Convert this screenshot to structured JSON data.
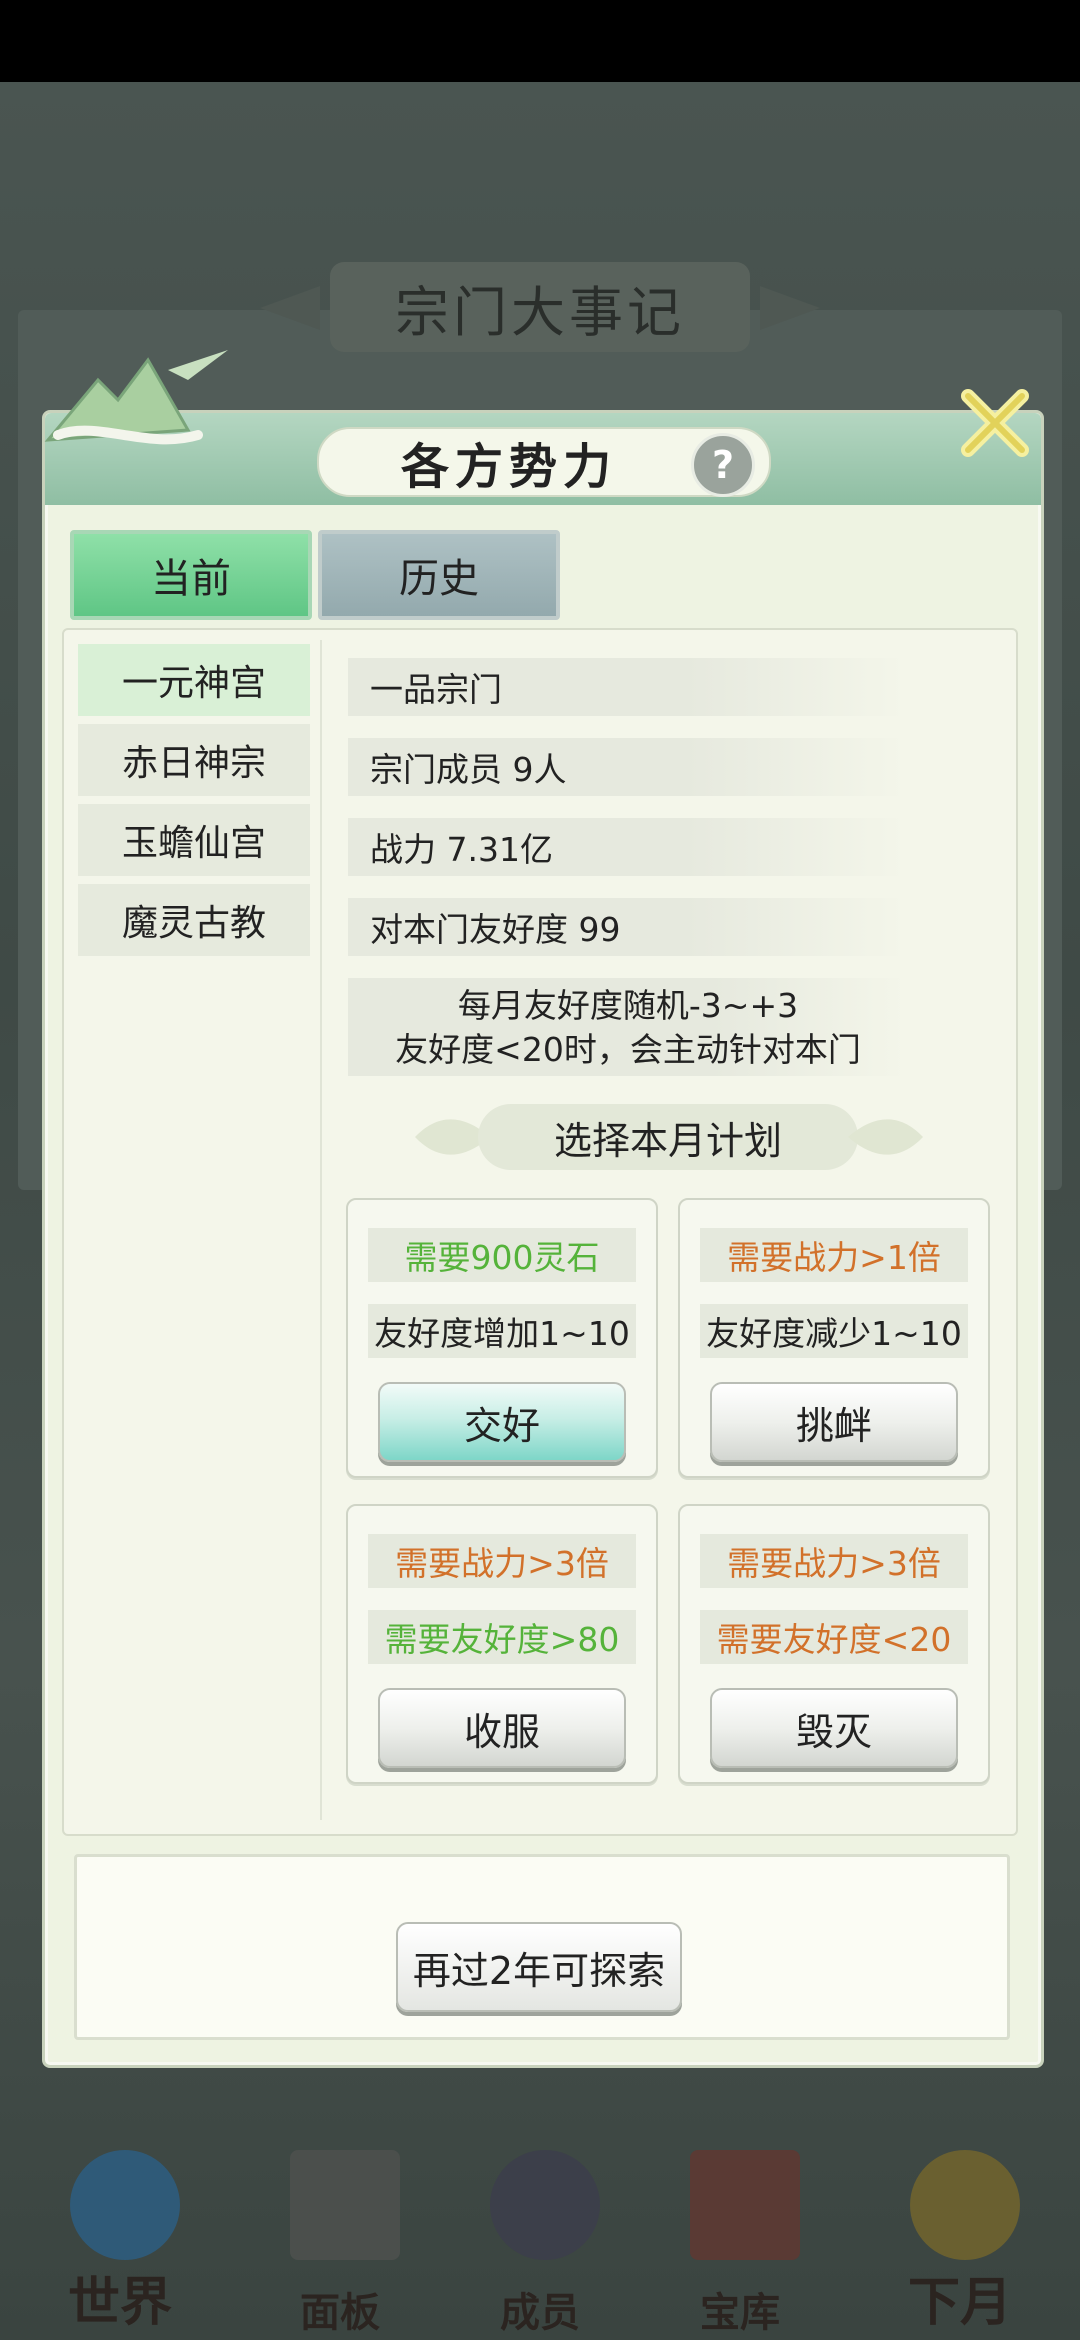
{
  "background": {
    "banner_title": "宗门大事记"
  },
  "dialog": {
    "title": "各方势力",
    "help_label": "?"
  },
  "tabs": [
    {
      "label": "当前",
      "active": true
    },
    {
      "label": "历史",
      "active": false
    }
  ],
  "sects": [
    {
      "name": "一元神宫",
      "selected": true
    },
    {
      "name": "赤日神宗",
      "selected": false
    },
    {
      "name": "玉蟾仙宫",
      "selected": false
    },
    {
      "name": "魔灵古教",
      "selected": false
    }
  ],
  "info": {
    "rank": "一品宗门",
    "members": "宗门成员 9人",
    "power": "战力 7.31亿",
    "friendship": "对本门友好度 99",
    "note_line1": "每月友好度随机-3~+3",
    "note_line2": "友好度<20时，会主动针对本门"
  },
  "plan": {
    "title": "选择本月计划",
    "cards": [
      {
        "req1": "需要900灵石",
        "req1_color": "#55b33a",
        "req2": "友好度增加1~10",
        "action": "交好"
      },
      {
        "req1": "需要战力>1倍",
        "req1_color": "#d2712a",
        "req2": "友好度减少1~10",
        "action": "挑衅"
      },
      {
        "req1": "需要战力>3倍",
        "req1_color": "#d2712a",
        "req2": "需要友好度>80",
        "action": "收服"
      },
      {
        "req1": "需要战力>3倍",
        "req1_color": "#d2712a",
        "req2": "需要友好度<20",
        "action": "毁灭"
      }
    ]
  },
  "explore": {
    "button_label": "再过2年可探索"
  },
  "bottom_nav": [
    {
      "label": "世界",
      "icon": "world-icon"
    },
    {
      "label": "面板",
      "icon": "panel-icon"
    },
    {
      "label": "成员",
      "icon": "members-icon"
    },
    {
      "label": "宝库",
      "icon": "treasury-icon"
    },
    {
      "label": "下月",
      "icon": "moon-icon"
    }
  ]
}
